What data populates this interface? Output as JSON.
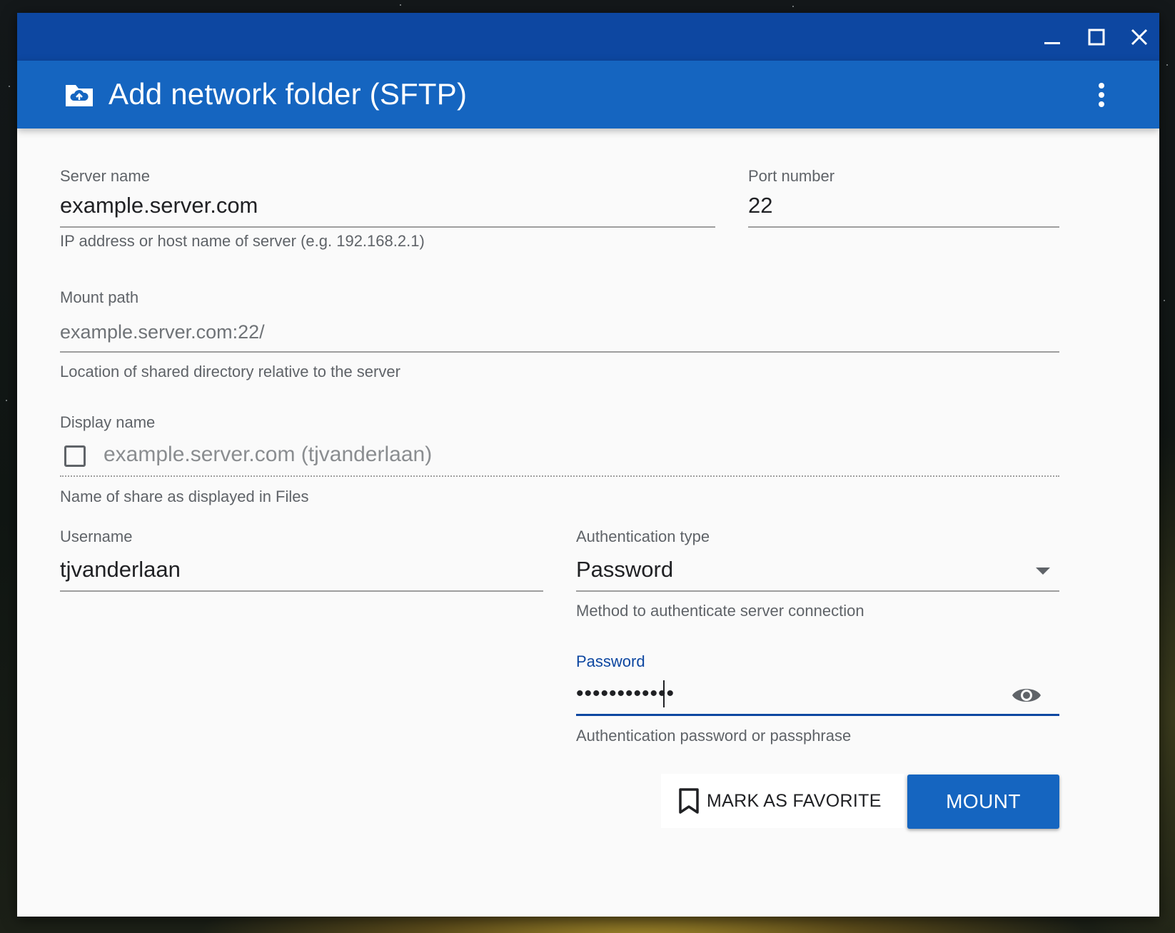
{
  "window": {
    "title": "Add network folder (SFTP)",
    "controls": [
      "minimize",
      "maximize",
      "close"
    ]
  },
  "form": {
    "server_name": {
      "label": "Server name",
      "value": "example.server.com",
      "helper": "IP address or host name of server (e.g. 192.168.2.1)"
    },
    "port_number": {
      "label": "Port number",
      "value": "22"
    },
    "mount_path": {
      "label": "Mount path",
      "value": "example.server.com:22/",
      "helper": "Location of shared directory relative to the server"
    },
    "display_name": {
      "label": "Display name",
      "value": "example.server.com (tjvanderlaan)",
      "helper": "Name of share as displayed in Files",
      "checked": false
    },
    "username": {
      "label": "Username",
      "value": "tjvanderlaan"
    },
    "auth_type": {
      "label": "Authentication type",
      "value": "Password",
      "helper": "Method to authenticate server connection"
    },
    "password": {
      "label": "Password",
      "masked_value": "••••••••••••",
      "helper": "Authentication password or passphrase"
    }
  },
  "actions": {
    "favorite_label": "MARK AS FAVORITE",
    "mount_label": "MOUNT"
  },
  "colors": {
    "titlebar": "#0d47a1",
    "appbar": "#1565c0",
    "accent": "#0d47a1",
    "primary_button": "#1565c0"
  },
  "icons": {
    "app": "cloud-folder-icon",
    "more": "more-vertical-icon",
    "favorite": "bookmark-icon",
    "password_toggle": "eye-icon"
  }
}
